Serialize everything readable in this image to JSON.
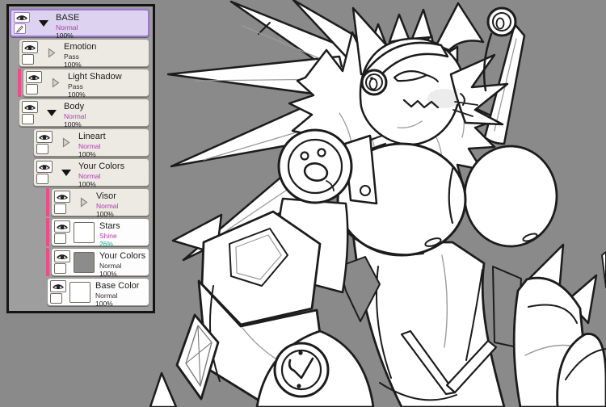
{
  "colors": {
    "canvas_bg": "#8a8a8a",
    "panel_bg": "#9e9e9e",
    "panel_border": "#141414",
    "row_folder_bg": "#edeae4",
    "row_layer_bg": "#fdfdfd",
    "row_border": "#9a948c",
    "selected_bg": "#ddd3f1",
    "selected_border": "#9b79c9",
    "stripe_pink": "#ec4c87",
    "mode_accent": "#b13ab1",
    "mode_plain": "#3a2a2a",
    "opacity_teal": "#1ea390",
    "text_dark": "#1c1c1c",
    "lineart": "#1c1c1c",
    "art_white": "#ffffff"
  },
  "icons": {
    "visibility": "eye-icon",
    "edit": "pencil-icon",
    "expanded": "triangle-down-icon",
    "collapsed": "triangle-right-icon"
  },
  "panel": {
    "selected_layer": "BASE",
    "layers": [
      {
        "name": "BASE",
        "mode": "Normal",
        "opacity": "100%",
        "type": "folder",
        "depth": 0,
        "expanded": true,
        "stripe": false,
        "selected": true
      },
      {
        "name": "Emotion",
        "mode": "Pass",
        "opacity": "100%",
        "type": "folder",
        "depth": 1,
        "expanded": false,
        "stripe": false,
        "selected": false
      },
      {
        "name": "Light Shadow",
        "mode": "Pass",
        "opacity": "100%",
        "type": "folder",
        "depth": 1,
        "expanded": false,
        "stripe": true,
        "selected": false
      },
      {
        "name": "Body",
        "mode": "Normal",
        "opacity": "100%",
        "type": "folder",
        "depth": 1,
        "expanded": true,
        "stripe": false,
        "selected": false
      },
      {
        "name": "Lineart",
        "mode": "Normal",
        "opacity": "100%",
        "type": "folder",
        "depth": 2,
        "expanded": false,
        "stripe": false,
        "selected": false
      },
      {
        "name": "Your Colors",
        "mode": "Normal",
        "opacity": "100%",
        "type": "folder",
        "depth": 2,
        "expanded": true,
        "stripe": false,
        "selected": false
      },
      {
        "name": "Visor",
        "mode": "Normal",
        "opacity": "100%",
        "type": "folder",
        "depth": 3,
        "expanded": false,
        "stripe": true,
        "selected": false
      },
      {
        "name": "Stars",
        "mode": "Shine",
        "opacity": "26%",
        "type": "layer",
        "depth": 3,
        "expanded": false,
        "stripe": true,
        "selected": false,
        "thumbnail": "white"
      },
      {
        "name": "Your Colors",
        "mode": "Normal",
        "opacity": "100%",
        "type": "layer",
        "depth": 3,
        "expanded": false,
        "stripe": true,
        "selected": false,
        "thumbnail": "gray"
      },
      {
        "name": "Base Color",
        "mode": "Normal",
        "opacity": "100%",
        "type": "layer",
        "depth": 3,
        "expanded": false,
        "stripe": false,
        "selected": false,
        "thumbnail": "white"
      }
    ]
  },
  "canvas": {
    "artwork": "anthro-character-lineart"
  }
}
